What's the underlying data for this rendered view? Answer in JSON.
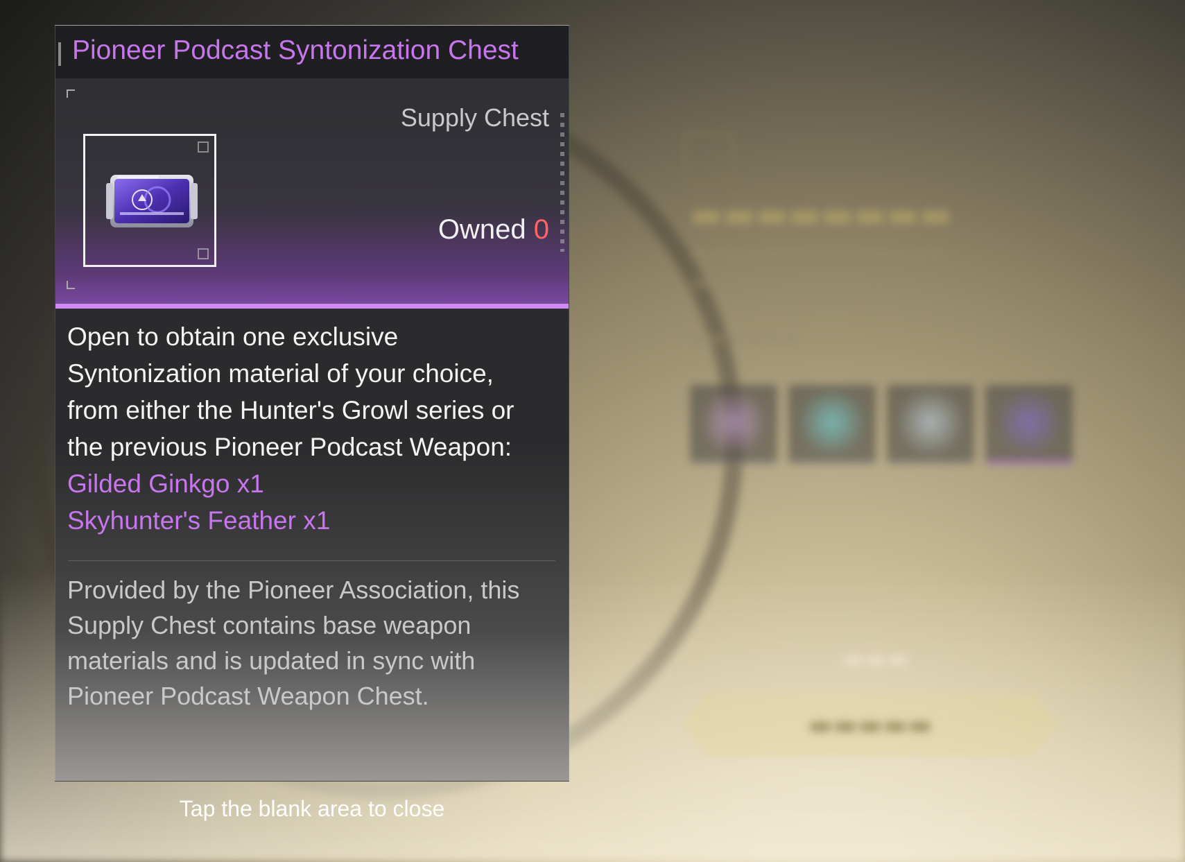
{
  "tooltip": {
    "title": "Pioneer Podcast Syntonization Chest",
    "item_type": "Supply Chest",
    "owned_label": "Owned",
    "owned_count": "0",
    "description_lines": [
      "Open to obtain one exclusive",
      "Syntonization material of your choice,",
      "from either the Hunter's Growl series or",
      "the previous Pioneer Podcast Weapon:"
    ],
    "options": [
      "Gilded Ginkgo x1",
      "Skyhunter's Feather x1"
    ],
    "lore_lines": [
      "Provided by the Pioneer Association, this",
      "Supply Chest contains base weapon",
      "materials and is updated in sync with",
      "Pioneer Podcast Weapon Chest."
    ],
    "icon": "purple-supply-chest-icon",
    "colors": {
      "title": "#c776ee",
      "owned_count": "#ff6363",
      "accent_line": "#cf8af5"
    }
  },
  "close_hint": "Tap the blank area to close"
}
